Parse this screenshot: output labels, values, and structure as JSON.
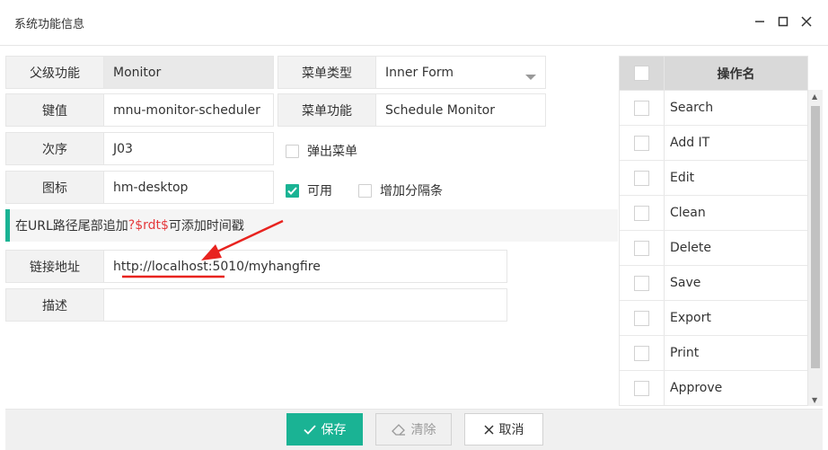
{
  "window": {
    "title": "系统功能信息"
  },
  "form": {
    "parent_label": "父级功能",
    "parent_value": "Monitor",
    "menu_type_label": "菜单类型",
    "menu_type_value": "Inner Form",
    "key_label": "键值",
    "key_value": "mnu-monitor-scheduler",
    "menu_func_label": "菜单功能",
    "menu_func_value": "Schedule Monitor",
    "order_label": "次序",
    "order_value": "J03",
    "popup_label": "弹出菜单",
    "popup_checked": false,
    "icon_label": "图标",
    "icon_value": "hm-desktop",
    "enabled_label": "可用",
    "enabled_checked": true,
    "separator_label": "增加分隔条",
    "separator_checked": false,
    "tip_prefix": "在URL路径尾部追加",
    "tip_highlight": "?$rdt$",
    "tip_suffix": "可添加时间戳",
    "url_label": "链接地址",
    "url_value": "http://localhost:5010/myhangfire",
    "desc_label": "描述",
    "desc_value": ""
  },
  "actions_grid": {
    "header": "操作名",
    "rows": [
      "Search",
      "Add IT",
      "Edit",
      "Clean",
      "Delete",
      "Save",
      "Export",
      "Print",
      "Approve"
    ]
  },
  "footer": {
    "save": "保存",
    "clear": "清除",
    "cancel": "取消"
  },
  "colors": {
    "accent": "#1ab394",
    "annotation": "#e8231f",
    "highlight": "#e4393c"
  }
}
